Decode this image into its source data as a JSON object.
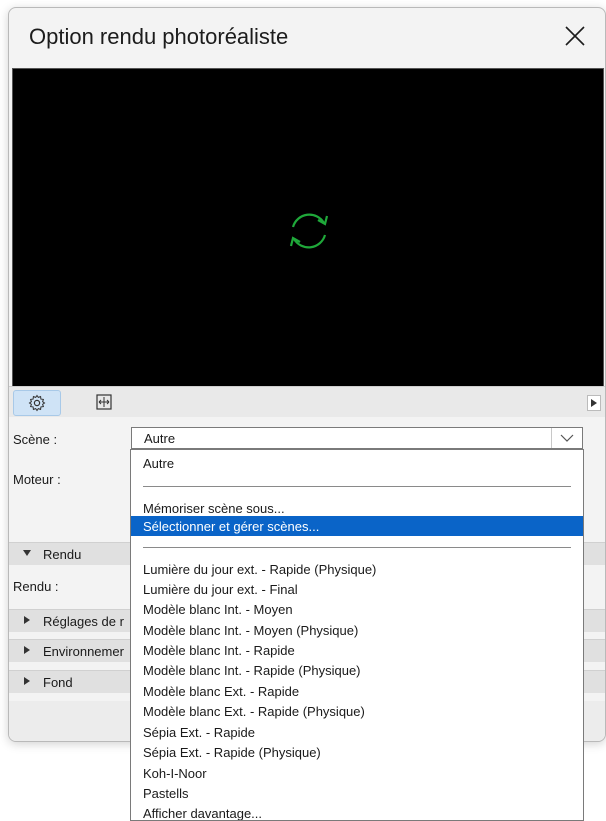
{
  "dialog": {
    "title": "Option rendu photoréaliste",
    "close_icon": "close-icon"
  },
  "preview": {
    "status_icon": "refresh-icon",
    "icon_color": "#1fa83a"
  },
  "toolbar": {
    "settings_icon": "gear-icon",
    "size_icon": "frame-size-icon"
  },
  "form": {
    "scene_label": "Scène :",
    "scene_value": "Autre",
    "engine_label": "Moteur :",
    "render_label": "Rendu :"
  },
  "sections": {
    "rendu": "Rendu",
    "reglages": "Réglages de r",
    "environnement": "Environnemer",
    "fond": "Fond"
  },
  "dropdown": {
    "items": [
      "Autre",
      "Mémoriser scène sous...",
      "Sélectionner et gérer scènes...",
      "Lumière du jour ext. - Rapide (Physique)",
      "Lumière du jour ext. - Final",
      "Modèle blanc Int. - Moyen",
      "Modèle blanc Int. - Moyen (Physique)",
      "Modèle blanc Int. - Rapide",
      "Modèle blanc Int. - Rapide (Physique)",
      "Modèle blanc Ext. - Rapide",
      "Modèle blanc Ext. - Rapide (Physique)",
      "Sépia Ext. - Rapide",
      "Sépia Ext. - Rapide (Physique)",
      "Koh-I-Noor",
      "Pastells",
      "Afficher davantage..."
    ],
    "highlighted": "Sélectionner et gérer scènes..."
  },
  "colors": {
    "highlight": "#0a64c8",
    "toolbar_active": "#cfe3f6"
  }
}
